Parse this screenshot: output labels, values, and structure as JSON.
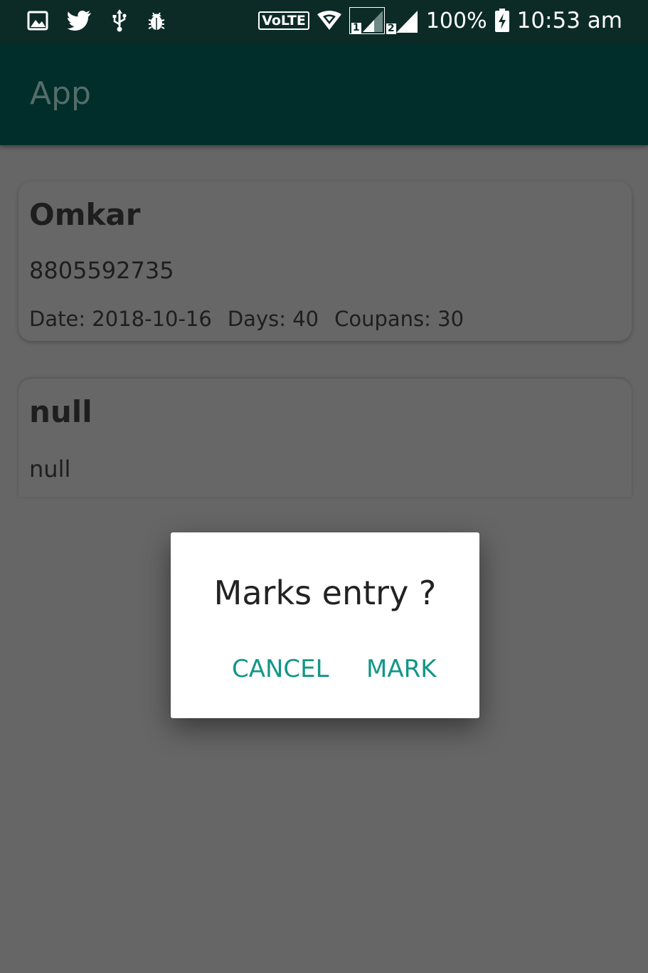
{
  "status_bar": {
    "volte": "VoLTE",
    "sim1": "1",
    "sim2": "2",
    "battery": "100%",
    "time": "10:53 am",
    "left_icons": [
      "gallery-icon",
      "twitter-icon",
      "usb-icon",
      "bug-icon"
    ],
    "right_icons": [
      "wifi-icon",
      "signal-icon",
      "battery-charging-icon"
    ]
  },
  "app_bar": {
    "title": "App"
  },
  "cards": [
    {
      "name": "Omkar",
      "phone": "8805592735",
      "date": "Date: 2018-10-16",
      "days": "Days: 40",
      "coupans": "Coupans: 30"
    },
    {
      "name": "null",
      "phone": "null"
    }
  ],
  "dialog": {
    "message": "Marks entry ?",
    "cancel_label": "CANCEL",
    "mark_label": "MARK"
  },
  "colors": {
    "status_bar": "#0c2b27",
    "app_bar": "#012e2a",
    "scrim_background": "#666666",
    "dialog_button": "#139688"
  }
}
